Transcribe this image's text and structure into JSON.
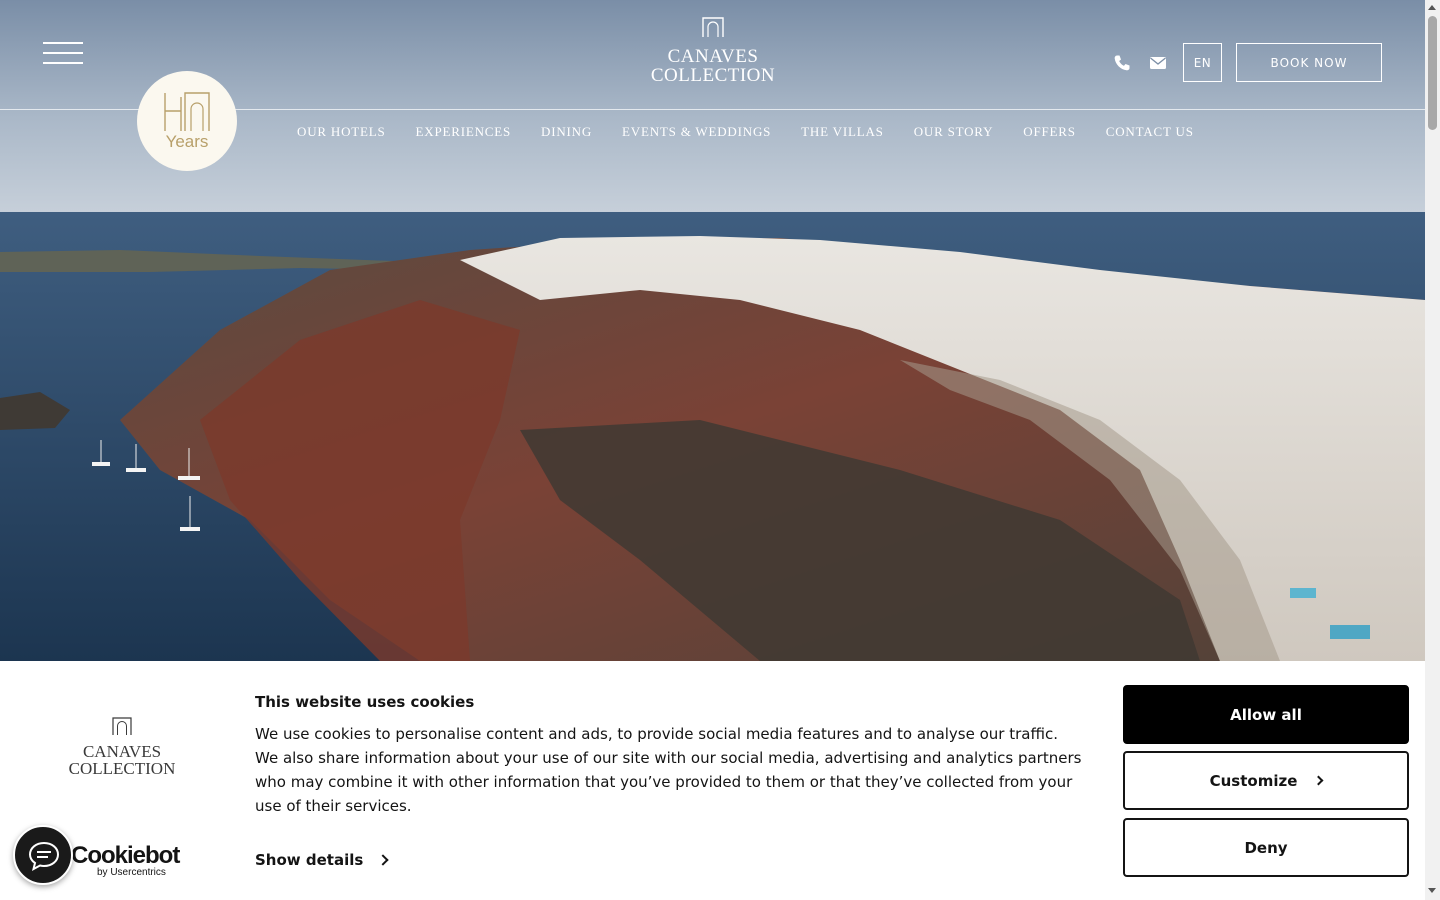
{
  "header": {
    "logo_line1": "CANAVES",
    "logo_line2": "COLLECTION",
    "lang": "EN",
    "book_now": "BOOK NOW",
    "badge_years": "Years",
    "badge_number": "40"
  },
  "nav": {
    "items": [
      {
        "label": "OUR HOTELS"
      },
      {
        "label": "EXPERIENCES"
      },
      {
        "label": "DINING"
      },
      {
        "label": "EVENTS & WEDDINGS"
      },
      {
        "label": "THE VILLAS"
      },
      {
        "label": "OUR STORY"
      },
      {
        "label": "OFFERS"
      },
      {
        "label": "CONTACT US"
      }
    ]
  },
  "cookie": {
    "logo_line1": "CANAVES",
    "logo_line2": "COLLECTION",
    "title": "This website uses cookies",
    "body": "We use cookies to personalise content and ads, to provide social media features and to analyse our traffic. We also share information about your use of our site with our social media, advertising and analytics partners who may combine it with other information that you’ve provided to them or that they’ve collected from your use of their services.",
    "show_details": "Show details",
    "allow_all": "Allow all",
    "customize": "Customize",
    "deny": "Deny",
    "brand_name": "Cookiebot",
    "brand_by": "by Usercentrics"
  },
  "icons": {
    "menu": "hamburger-menu-icon",
    "phone": "phone-icon",
    "mail": "envelope-icon",
    "chat": "chat-bubble-icon"
  },
  "colors": {
    "badge_bg": "#fbf8ef",
    "badge_gold": "#b8a06a",
    "allow_bg": "#000000",
    "text_dark": "#141414"
  }
}
